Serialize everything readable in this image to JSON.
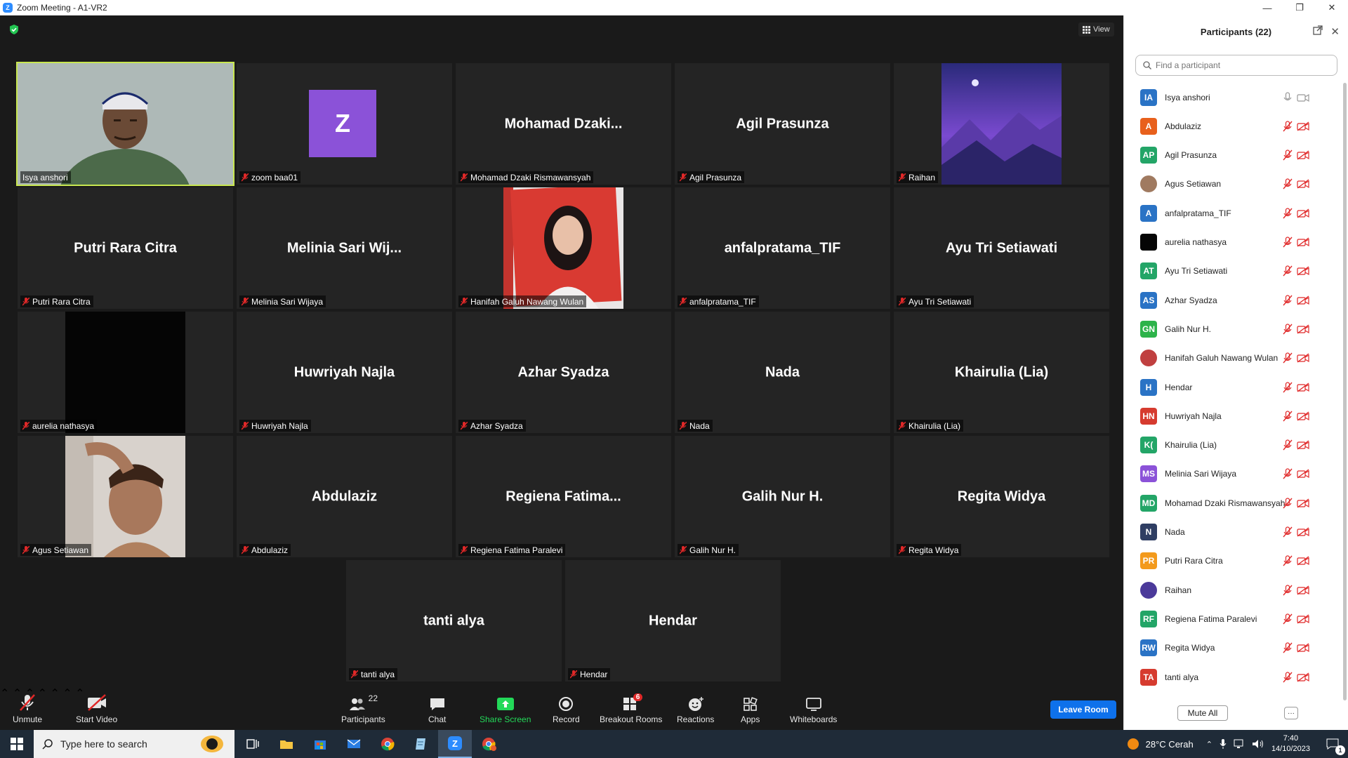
{
  "window": {
    "title": "Zoom Meeting - A1-VR2",
    "logo_letter": "Z"
  },
  "meeting": {
    "view_label": "View"
  },
  "tiles": [
    {
      "id": "isya",
      "big": "",
      "label": "Isya anshori",
      "muted": false,
      "active": true
    },
    {
      "id": "zoom",
      "big": "",
      "label": "zoom baa01",
      "muted": true,
      "avatar_letter": "Z"
    },
    {
      "id": "dzaki",
      "big": "Mohamad  Dzaki...",
      "label": "Mohamad Dzaki Rismawansyah",
      "muted": true
    },
    {
      "id": "agil",
      "big": "Agil Prasunza",
      "label": "Agil Prasunza",
      "muted": true
    },
    {
      "id": "raihan",
      "big": "",
      "label": "Raihan",
      "muted": true
    },
    {
      "id": "putri",
      "big": "Putri Rara Citra",
      "label": "Putri Rara Citra",
      "muted": true
    },
    {
      "id": "melinia",
      "big": "Melinia  Sari  Wij...",
      "label": "Melinia Sari Wijaya",
      "muted": true
    },
    {
      "id": "hanifah",
      "big": "",
      "label": "Hanifah Galuh Nawang Wulan",
      "muted": true
    },
    {
      "id": "anfal",
      "big": "anfalpratama_TIF",
      "label": "anfalpratama_TIF",
      "muted": true
    },
    {
      "id": "ayu",
      "big": "Ayu Tri Setiawati",
      "label": "Ayu Tri Setiawati",
      "muted": true
    },
    {
      "id": "aurelia",
      "big": "",
      "label": "aurelia nathasya",
      "muted": true
    },
    {
      "id": "huwriyah",
      "big": "Huwriyah Najla",
      "label": "Huwriyah Najla",
      "muted": true
    },
    {
      "id": "azhar",
      "big": "Azhar Syadza",
      "label": "Azhar Syadza",
      "muted": true
    },
    {
      "id": "nada",
      "big": "Nada",
      "label": "Nada",
      "muted": true
    },
    {
      "id": "khairulia",
      "big": "Khairulia (Lia)",
      "label": "Khairulia (Lia)",
      "muted": true
    },
    {
      "id": "agus",
      "big": "",
      "label": "Agus Setiawan",
      "muted": true
    },
    {
      "id": "abdulaziz",
      "big": "Abdulaziz",
      "label": "Abdulaziz",
      "muted": true
    },
    {
      "id": "regiena",
      "big": "Regiena  Fatima...",
      "label": "Regiena Fatima Paralevi",
      "muted": true
    },
    {
      "id": "galih",
      "big": "Galih Nur H.",
      "label": "Galih Nur H.",
      "muted": true
    },
    {
      "id": "regita",
      "big": "Regita Widya",
      "label": "Regita Widya",
      "muted": true
    },
    {
      "id": "tanti",
      "big": "tanti alya",
      "label": "tanti alya",
      "muted": true
    },
    {
      "id": "hendar",
      "big": "Hendar",
      "label": "Hendar",
      "muted": true
    }
  ],
  "toolbar": {
    "unmute": "Unmute",
    "start_video": "Start Video",
    "participants": "Participants",
    "participants_count": "22",
    "chat": "Chat",
    "share_screen": "Share Screen",
    "record": "Record",
    "breakout_rooms": "Breakout Rooms",
    "breakout_badge": "6",
    "reactions": "Reactions",
    "apps": "Apps",
    "whiteboards": "Whiteboards",
    "leave": "Leave Room"
  },
  "panel": {
    "title": "Participants (22)",
    "search_placeholder": "Find a participant",
    "mute_all": "Mute All",
    "more": "···",
    "participants": [
      {
        "initials": "IA",
        "name": "Isya anshori",
        "color": "#2a73c5",
        "muted": false
      },
      {
        "initials": "A",
        "name": "Abdulaziz",
        "color": "#e8601c",
        "muted": true
      },
      {
        "initials": "AP",
        "name": "Agil Prasunza",
        "color": "#23a567",
        "muted": true
      },
      {
        "initials": "",
        "name": "Agus Setiawan",
        "color": "#a07a60",
        "muted": true,
        "photo": true
      },
      {
        "initials": "A",
        "name": "anfalpratama_TIF",
        "color": "#2a73c5",
        "muted": true
      },
      {
        "initials": "",
        "name": "aurelia nathasya",
        "color": "#050505",
        "muted": true
      },
      {
        "initials": "AT",
        "name": "Ayu Tri Setiawati",
        "color": "#23a567",
        "muted": true
      },
      {
        "initials": "AS",
        "name": "Azhar Syadza",
        "color": "#2a73c5",
        "muted": true
      },
      {
        "initials": "GN",
        "name": "Galih Nur H.",
        "color": "#2db34a",
        "muted": true
      },
      {
        "initials": "",
        "name": "Hanifah Galuh Nawang Wulan",
        "color": "#c04040",
        "muted": true,
        "photo": true
      },
      {
        "initials": "H",
        "name": "Hendar",
        "color": "#2a73c5",
        "muted": true
      },
      {
        "initials": "HN",
        "name": "Huwriyah Najla",
        "color": "#d63b2f",
        "muted": true
      },
      {
        "initials": "K(",
        "name": "Khairulia (Lia)",
        "color": "#23a567",
        "muted": true
      },
      {
        "initials": "MS",
        "name": "Melinia Sari Wijaya",
        "color": "#8b52d8",
        "muted": true
      },
      {
        "initials": "MD",
        "name": "Mohamad Dzaki Rismawansyah",
        "color": "#23a567",
        "muted": true
      },
      {
        "initials": "N",
        "name": "Nada",
        "color": "#2f3e63",
        "muted": true
      },
      {
        "initials": "PR",
        "name": "Putri Rara Citra",
        "color": "#f39a1c",
        "muted": true
      },
      {
        "initials": "",
        "name": "Raihan",
        "color": "#4b3a9a",
        "muted": true,
        "photo": true
      },
      {
        "initials": "RF",
        "name": "Regiena Fatima Paralevi",
        "color": "#23a567",
        "muted": true
      },
      {
        "initials": "RW",
        "name": "Regita Widya",
        "color": "#2a73c5",
        "muted": true
      },
      {
        "initials": "TA",
        "name": "tanti alya",
        "color": "#d63b2f",
        "muted": true
      }
    ]
  },
  "taskbar": {
    "search_placeholder": "Type here to search",
    "weather": "28°C  Cerah",
    "time": "7:40",
    "date": "14/10/2023",
    "notification_count": "1"
  }
}
